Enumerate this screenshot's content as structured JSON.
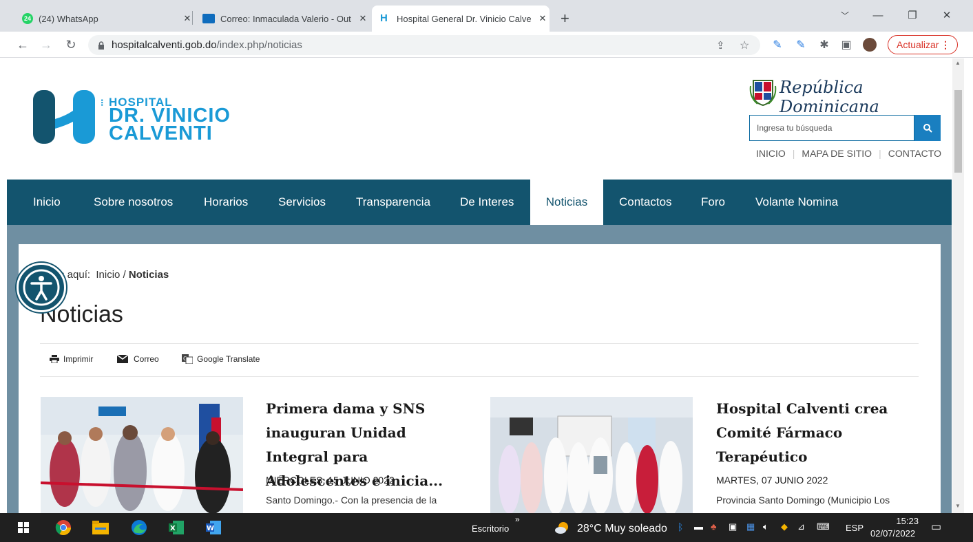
{
  "browser": {
    "tabs": [
      {
        "title": "(24) WhatsApp",
        "badge": "24"
      },
      {
        "title": "Correo: Inmaculada Valerio - Out"
      },
      {
        "title": "Hospital General Dr. Vinicio Calve"
      }
    ],
    "new_tab": "+",
    "url_host": "hospitalcalventi.gob.do",
    "url_path": "/index.php/noticias",
    "update_label": "Actualizar"
  },
  "site": {
    "logo_line1": "HOSPITAL",
    "logo_line2": "DR. VINICIO",
    "logo_line3": "CALVENTI",
    "rd_label": "República Dominicana",
    "search_placeholder": "Ingresa tu búsqueda",
    "top_links": [
      "INICIO",
      "MAPA DE SITIO",
      "CONTACTO"
    ],
    "nav": [
      "Inicio",
      "Sobre nosotros",
      "Horarios",
      "Servicios",
      "Transparencia",
      "De Interes",
      "Noticias",
      "Contactos",
      "Foro",
      "Volante Nomina"
    ],
    "nav_active": "Noticias",
    "accent": "#13546e"
  },
  "page": {
    "breadcrumb_prefix": "s aquí:",
    "breadcrumb_home": "Inicio",
    "breadcrumb_sep": "/",
    "breadcrumb_current": "Noticias",
    "title": "Noticias",
    "tools": {
      "print": "Imprimir",
      "email": "Correo",
      "translate": "Google Translate"
    }
  },
  "news": [
    {
      "title": "Primera dama y SNS inauguran Unidad Integral para Adolescentes e inicia...",
      "date": "MIÉRCOLES, 15 JUNIO 2022",
      "summary": "Santo Domingo.- Con la presencia de la"
    },
    {
      "title": "Hospital Calventi crea Comité Fármaco Terapéutico",
      "date": "MARTES, 07 JUNIO 2022",
      "summary": "Provincia Santo Domingo (Municipio Los"
    }
  ],
  "taskbar": {
    "desktop_label": "Escritorio",
    "weather": "28°C  Muy soleado",
    "lang": "ESP",
    "time": "15:23",
    "date": "02/07/2022"
  }
}
